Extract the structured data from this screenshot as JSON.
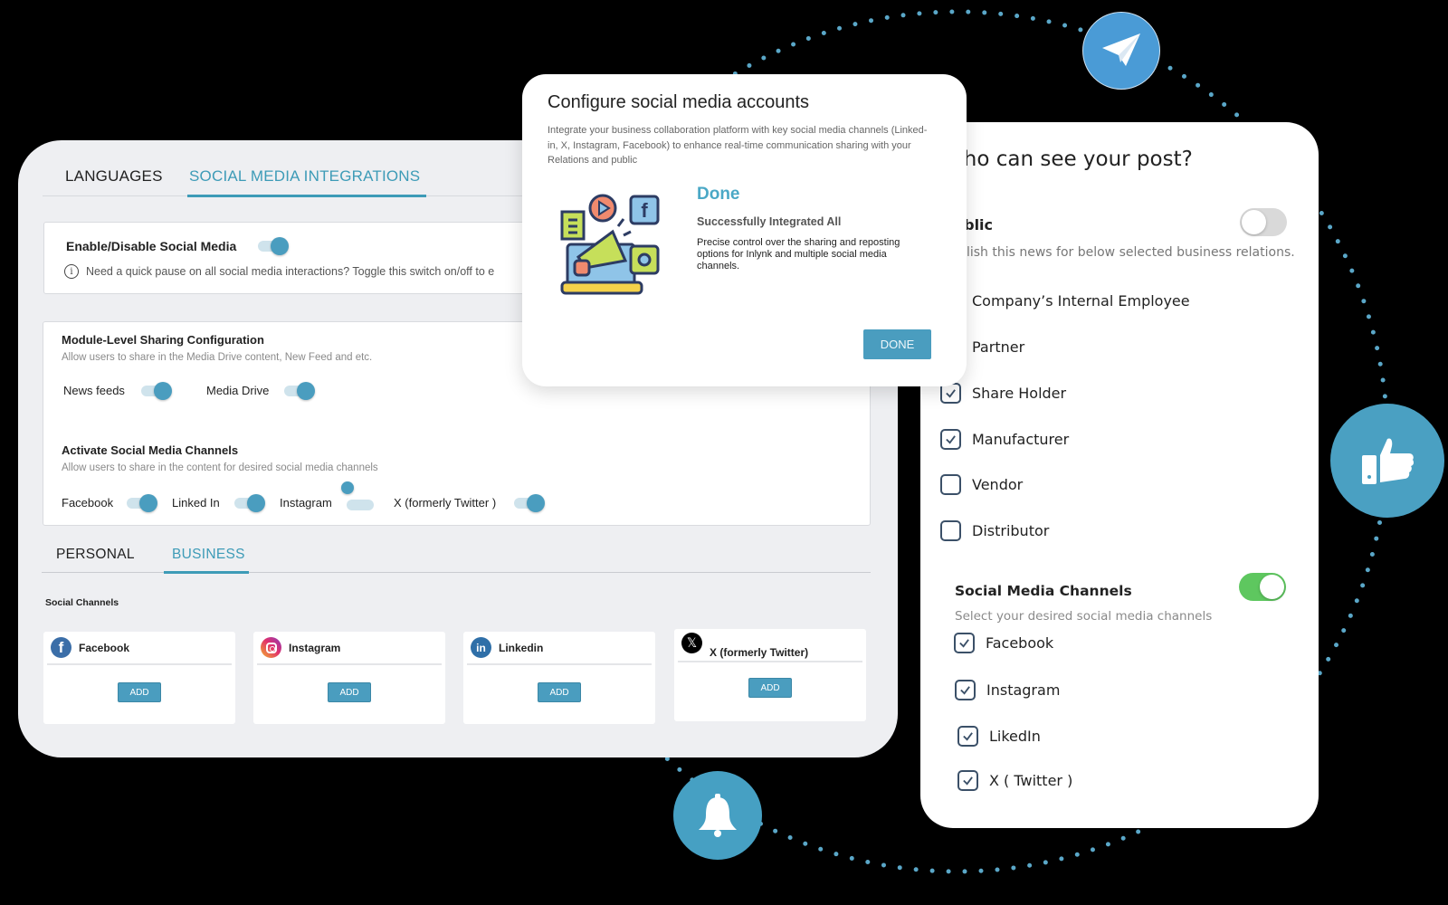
{
  "colors": {
    "accent": "#3d9bb7",
    "toggle_on_green": "#5ec75f",
    "orbit_dots": "#5aa7c8"
  },
  "orbit_icons": {
    "telegram": "paper-plane-icon",
    "like": "thumbs-up-icon",
    "bell": "bell-icon"
  },
  "settings": {
    "tabs": [
      {
        "label": "LANGUAGES",
        "active": false
      },
      {
        "label": "SOCIAL MEDIA INTEGRATIONS",
        "active": true
      }
    ],
    "enable": {
      "title": "Enable/Disable Social Media",
      "toggle_on": true,
      "info": "Need a quick pause on all social media interactions? Toggle this switch on/off to e"
    },
    "module": {
      "title": "Module-Level Sharing Configuration",
      "subtitle": "Allow users to share in the Media Drive content, New Feed and etc.",
      "toggles": [
        {
          "label": "News feeds",
          "on": true
        },
        {
          "label": "Media Drive",
          "on": true
        }
      ]
    },
    "channels": {
      "title": "Activate Social Media Channels",
      "subtitle": "Allow users to share in the content for  desired social media channels",
      "toggles": [
        {
          "label": "Facebook",
          "on": true
        },
        {
          "label": "Linked In",
          "on": true
        },
        {
          "label": "Instagram",
          "on": false
        },
        {
          "label": "X (formerly Twitter )",
          "on": true
        }
      ]
    },
    "account_tabs": [
      {
        "label": "PERSONAL",
        "active": false
      },
      {
        "label": "BUSINESS",
        "active": true
      }
    ],
    "social_channels_label": "Social Channels",
    "social_cards": [
      {
        "name": "Facebook",
        "icon": "facebook-icon",
        "button": "ADD"
      },
      {
        "name": "Instagram",
        "icon": "instagram-icon",
        "button": "ADD"
      },
      {
        "name": "Linkedin",
        "icon": "linkedin-icon",
        "button": "ADD"
      },
      {
        "name": "X (formerly Twitter)",
        "icon": "x-icon",
        "button": "ADD"
      }
    ]
  },
  "modal": {
    "title": "Configure social media accounts",
    "description": "Integrate your business collaboration platform with key social media channels (Linked-in, X, Instagram, Facebook) to enhance real-time communication sharing with your  Relations and public",
    "status_title": "Done",
    "status_subtitle": "Successfully Integrated All",
    "status_description": "Precise control over the sharing and reposting options for Inlynk and multiple social media channels.",
    "button": "DONE"
  },
  "visibility": {
    "title": "Who can see your post?",
    "public_label": "Public",
    "public_on": false,
    "public_subtitle": "Publish this news for below selected business relations.",
    "relations": [
      {
        "label": "Company’s Internal Employee",
        "checked": true
      },
      {
        "label": "Partner",
        "checked": true
      },
      {
        "label": "Share Holder",
        "checked": true
      },
      {
        "label": "Manufacturer",
        "checked": true
      },
      {
        "label": "Vendor",
        "checked": false
      },
      {
        "label": "Distributor",
        "checked": false
      }
    ],
    "channels_title": "Social Media Channels",
    "channels_on": true,
    "channels_subtitle": "Select your  desired social media channels",
    "channels": [
      {
        "label": "Facebook",
        "checked": true
      },
      {
        "label": "Instagram",
        "checked": true
      },
      {
        "label": "LikedIn",
        "checked": true
      },
      {
        "label": "X ( Twitter )",
        "checked": true
      }
    ]
  }
}
